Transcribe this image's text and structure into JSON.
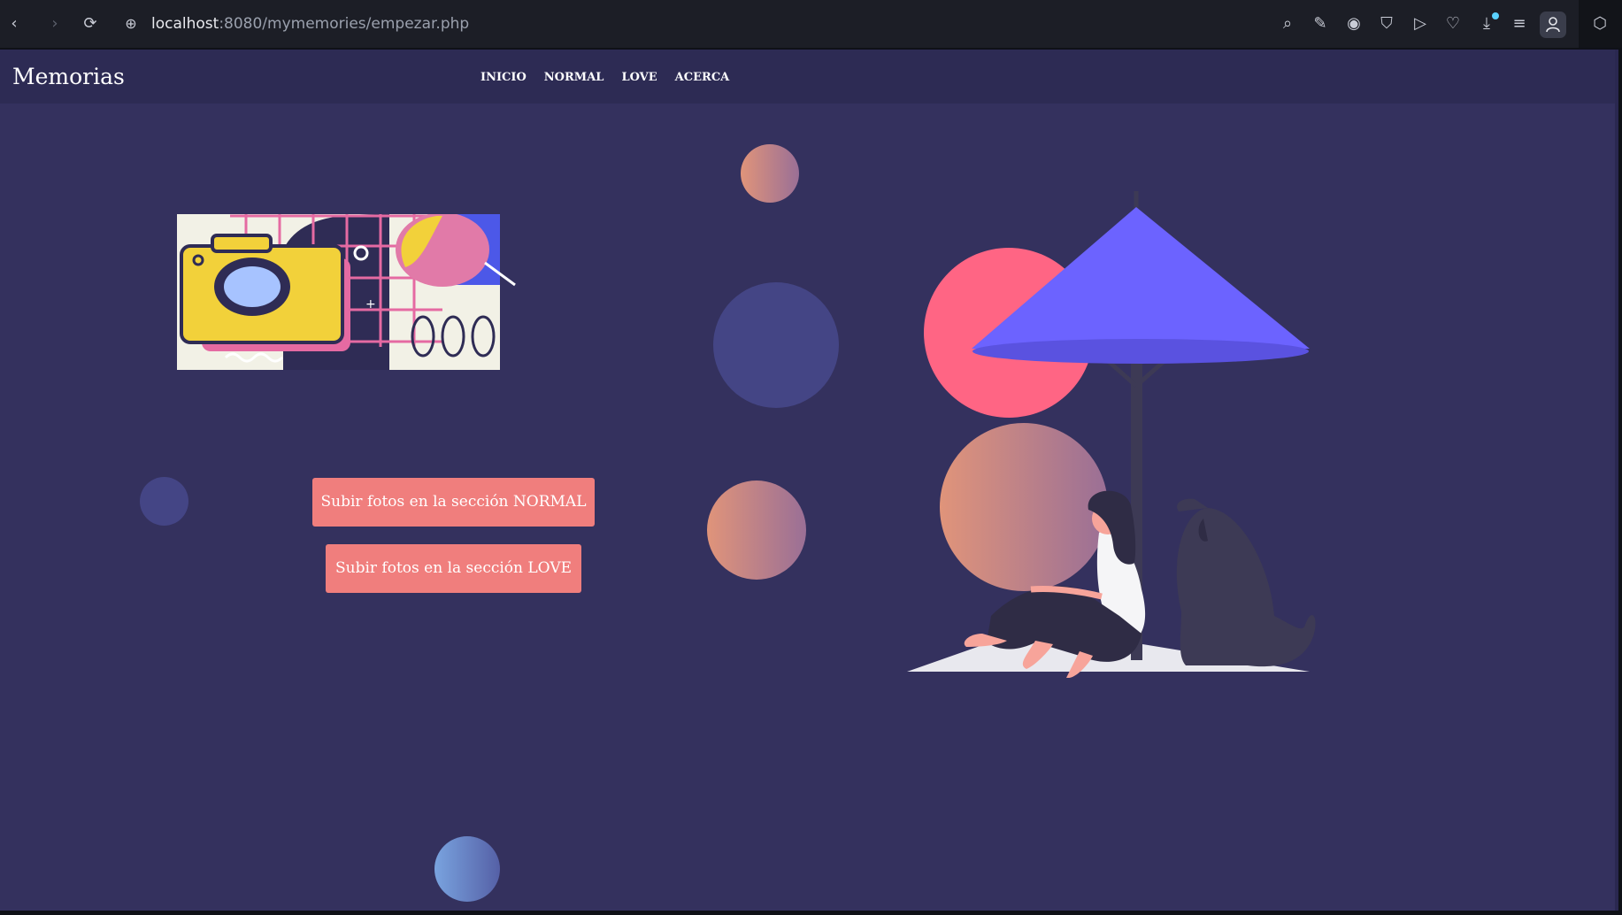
{
  "browser": {
    "url_host": "localhost",
    "url_path": ":8080/mymemories/empezar.php",
    "icons": [
      "back-icon",
      "forward-icon",
      "reload-icon",
      "site-info-icon",
      "zoom-search-icon",
      "edit-icon",
      "camera-icon",
      "shield-icon",
      "send-icon",
      "heart-icon",
      "download-icon",
      "menu-icon",
      "profile-icon",
      "extension-icon"
    ]
  },
  "navbar": {
    "brand": "Memorias",
    "links": [
      "INICIO",
      "NORMAL",
      "LOVE",
      "ACERCA"
    ]
  },
  "main": {
    "button_normal": "Subir fotos en la sección NORMAL",
    "button_love": "Subir fotos en la sección LOVE"
  },
  "colors": {
    "background": "#34315e",
    "navbar": "#2d2b54",
    "button": "#f07e7d",
    "umbrella": "#6c63ff",
    "sun": "#ff6584"
  }
}
